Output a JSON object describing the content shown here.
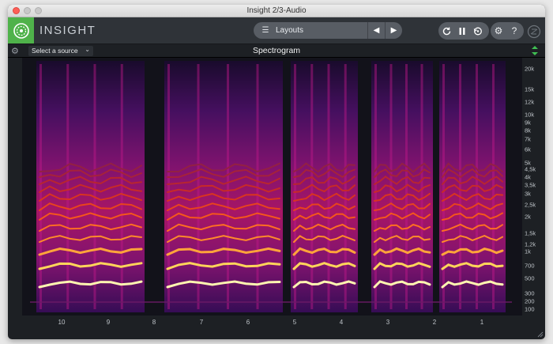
{
  "window": {
    "title": "Insight 2/3-Audio"
  },
  "header": {
    "app_name": "INSIGHT",
    "layouts_label": "Layouts",
    "icons": {
      "logo": "insight-logo-icon",
      "layouts_menu": "list-icon",
      "prev": "triangle-left-icon",
      "next": "triangle-right-icon",
      "loop": "loop-icon",
      "pause": "pause-icon",
      "reset": "reset-icon",
      "settings": "gear-icon",
      "help": "help-icon",
      "brand": "izotope-logo-icon"
    }
  },
  "toolbar": {
    "source_select": "Select a source",
    "panel_title": "Spectrogram"
  },
  "spectrogram": {
    "y_ticks": [
      "20k",
      "15k",
      "12k",
      "10k",
      "9k",
      "8k",
      "7k",
      "6k",
      "5k",
      "4,5k",
      "4k",
      "3,5k",
      "3k",
      "2,5k",
      "2k",
      "1,5k",
      "1,2k",
      "1k",
      "700",
      "500",
      "300",
      "200",
      "100"
    ],
    "x_ticks": [
      "10",
      "9",
      "8",
      "7",
      "6",
      "5",
      "4",
      "3",
      "2",
      "1"
    ],
    "colors": {
      "background": "#12121a",
      "low": "#3a0c5c",
      "mid": "#c31870",
      "high": "#ff7a1a",
      "peak": "#fff3a0"
    }
  }
}
